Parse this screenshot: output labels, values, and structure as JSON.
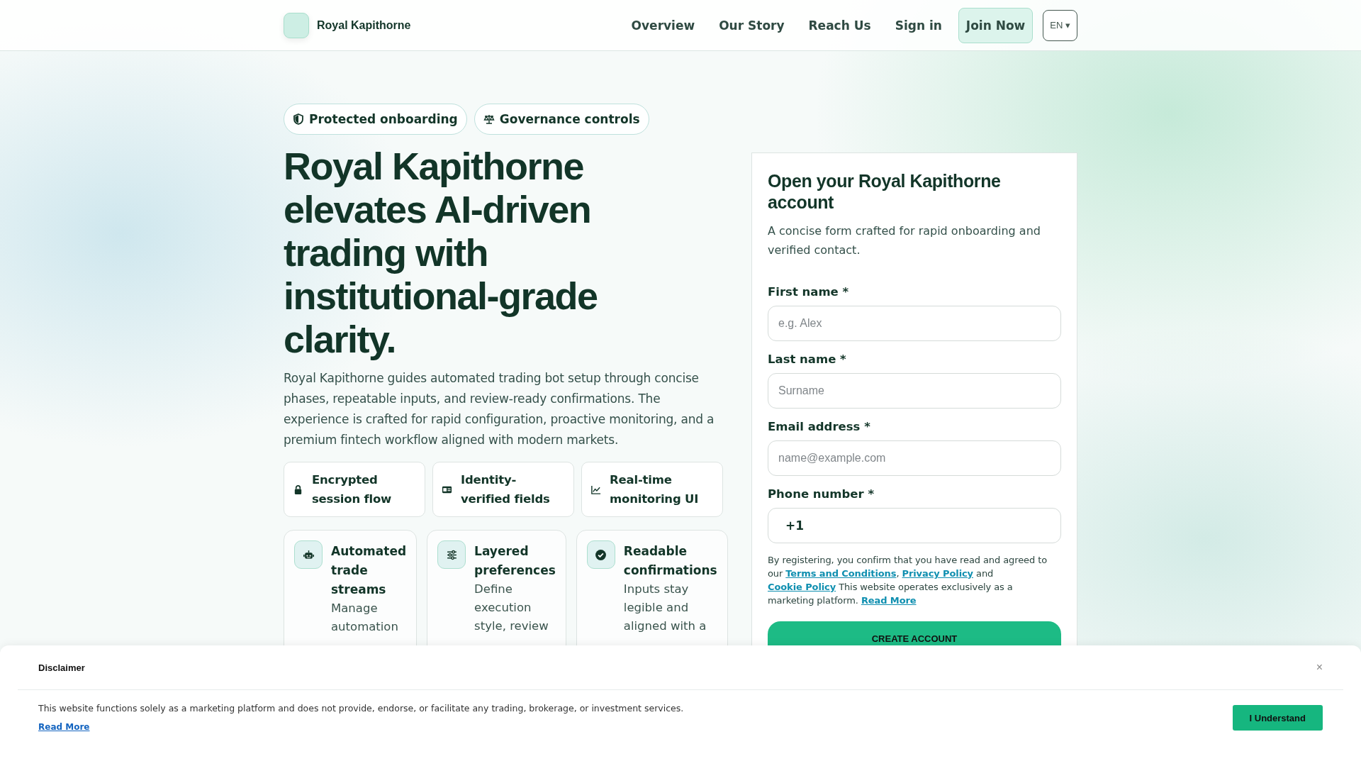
{
  "header": {
    "brand": "Royal Kapithorne",
    "nav": [
      {
        "label": "Overview"
      },
      {
        "label": "Our Story"
      },
      {
        "label": "Reach Us"
      },
      {
        "label": "Sign in"
      }
    ],
    "cta": "Join Now",
    "language": "EN ▾"
  },
  "hero": {
    "badges": [
      {
        "kind": "shield",
        "label": "Protected onboarding"
      },
      {
        "kind": "scales",
        "label": "Governance controls"
      }
    ],
    "title": "Royal Kapithorne elevates AI-driven trading with institutional-grade clarity.",
    "description": "Royal Kapithorne guides automated trading bot setup through concise phases, repeatable inputs, and review-ready confirmations. The experience is crafted for rapid configuration, proactive monitoring, and a premium fintech workflow aligned with modern markets.",
    "highlights": [
      {
        "kind": "lock",
        "label": "Encrypted session flow"
      },
      {
        "kind": "idcard",
        "label": "Identity-verified fields"
      },
      {
        "kind": "chart",
        "label": "Real-time monitoring UI"
      }
    ],
    "features": [
      {
        "kind": "robot",
        "title": "Automated trade streams",
        "text": "Manage automation"
      },
      {
        "kind": "sliders",
        "title": "Layered preferences",
        "text": "Define execution style, review"
      },
      {
        "kind": "check",
        "title": "Readable confirmations",
        "text": "Inputs stay legible and aligned with a"
      }
    ]
  },
  "form": {
    "title": "Open your Royal Kapithorne account",
    "subtitle": "A concise form crafted for rapid onboarding and verified contact.",
    "fields": [
      {
        "label": "First name *",
        "placeholder": "e.g. Alex"
      },
      {
        "label": "Last name *",
        "placeholder": "Surname"
      },
      {
        "label": "Email address *",
        "placeholder": "name@example.com"
      },
      {
        "label": "Phone number *",
        "value": "+1"
      }
    ],
    "consent": [
      {
        "kind": "text",
        "text": "By registering, you confirm that you have read and agreed to our "
      },
      {
        "kind": "link",
        "text": "Terms and Conditions"
      },
      {
        "kind": "text",
        "text": ", "
      },
      {
        "kind": "link",
        "text": "Privacy Policy"
      },
      {
        "kind": "text",
        "text": " and "
      },
      {
        "kind": "link",
        "text": "Cookie Policy"
      },
      {
        "kind": "text",
        "text": " This website operates exclusively as a marketing platform. "
      },
      {
        "kind": "link",
        "text": "Read More"
      }
    ],
    "submit": "CREATE ACCOUNT"
  },
  "disclaimer": {
    "title": "Disclaimer",
    "close": "×",
    "text": "This website functions solely as a marketing platform and does not provide, endorse, or facilitate any trading, brokerage, or investment services.",
    "link": "Read More",
    "button": "I Understand"
  }
}
